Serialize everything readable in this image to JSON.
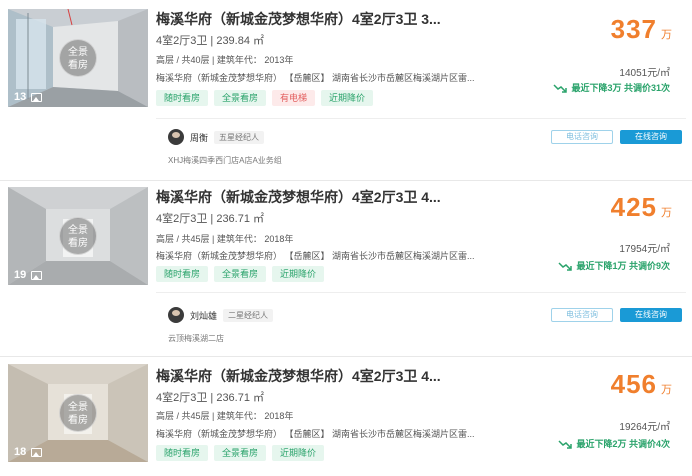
{
  "listings": [
    {
      "title": "梅溪华府（新城金茂梦想华府）4室2厅3卫 3...",
      "layout": "4室2厅3卫 | 239.84 ㎡",
      "floor": "高层 / 共40层 | 建筑年代： 2013年",
      "address": "梅溪华府（新城金茂梦想华府） 【岳麓区】 湖南省长沙市岳麓区梅溪湖片区雷...",
      "tags": [
        "随时看房",
        "全景看房",
        "有电梯",
        "近期降价"
      ],
      "photo_count": "13",
      "pano_label": "全景看房",
      "price": "337",
      "price_unit": "万",
      "unit_price": "14051元/㎡",
      "drop": "最近下降3万  共调价31次",
      "agent": {
        "name": "周衡",
        "badge": "五星经纪人",
        "store": "XHJ梅溪四季西门店A店A业务组"
      },
      "btn_phone": "电话咨询",
      "btn_chat": "在线咨询"
    },
    {
      "title": "梅溪华府（新城金茂梦想华府）4室2厅3卫 4...",
      "layout": "4室2厅3卫 | 236.71 ㎡",
      "floor": "高层 / 共45层 | 建筑年代： 2018年",
      "address": "梅溪华府（新城金茂梦想华府） 【岳麓区】 湖南省长沙市岳麓区梅溪湖片区雷...",
      "tags": [
        "随时看房",
        "全景看房",
        "近期降价"
      ],
      "photo_count": "19",
      "pano_label": "全景看房",
      "price": "425",
      "price_unit": "万",
      "unit_price": "17954元/㎡",
      "drop": "最近下降1万  共调价9次",
      "agent": {
        "name": "刘灿雄",
        "badge": "二星经纪人",
        "store": "云顶梅溪湖二店"
      },
      "btn_phone": "电话咨询",
      "btn_chat": "在线咨询"
    },
    {
      "title": "梅溪华府（新城金茂梦想华府）4室2厅3卫 4...",
      "layout": "4室2厅3卫 | 236.71 ㎡",
      "floor": "高层 / 共45层 | 建筑年代： 2018年",
      "address": "梅溪华府（新城金茂梦想华府） 【岳麓区】 湖南省长沙市岳麓区梅溪湖片区雷...",
      "tags": [
        "随时看房",
        "全景看房",
        "近期降价"
      ],
      "photo_count": "18",
      "pano_label": "全景看房",
      "price": "456",
      "price_unit": "万",
      "unit_price": "19264元/㎡",
      "drop": "最近下降2万  共调价4次"
    }
  ],
  "colors": {
    "price": "#f07f2d",
    "tag_green": "#2aa36b",
    "tag_red": "#e36060",
    "chat": "#1a9ad6"
  }
}
